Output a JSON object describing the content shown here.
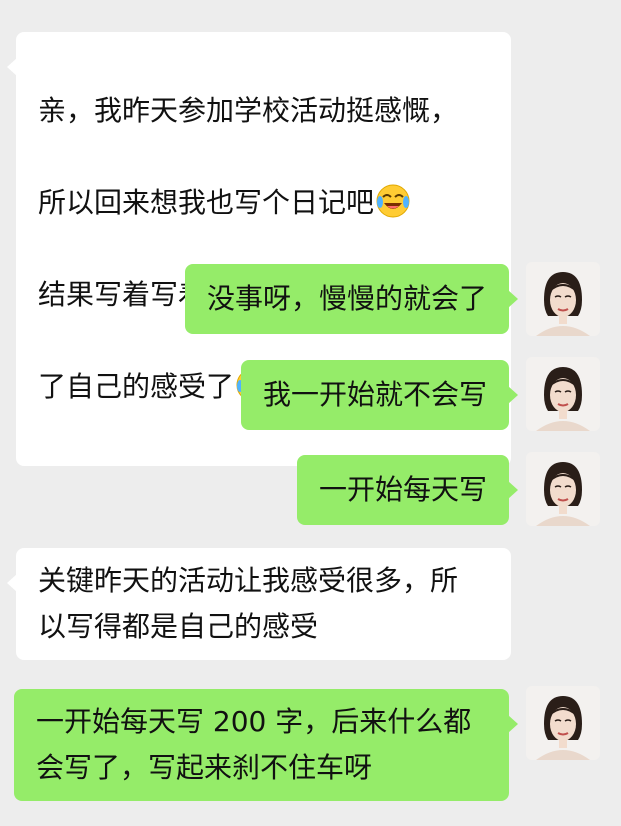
{
  "chat": {
    "messages": [
      {
        "side": "received",
        "lines": [
          "亲，我昨天参加学校活动挺感慨，",
          "所以回来想我也写个日记吧"
        ],
        "emoji_after_line_2": "face-with-tears-of-joy-icon",
        "lines_b": [
          "结果写着写着好像不是日记了，成",
          "了自己的感受了"
        ],
        "emoji_after_line_4": "face-with-tears-of-joy-icon"
      },
      {
        "side": "sent",
        "text": "没事呀，慢慢的就会了"
      },
      {
        "side": "sent",
        "text": "我一开始就不会写"
      },
      {
        "side": "sent",
        "text": "一开始每天写"
      },
      {
        "side": "received",
        "text": "关键昨天的活动让我感受很多，所\n以写得都是自己的感受"
      },
      {
        "side": "sent",
        "text": "一开始每天写 200 字，后来什么都\n会写了，写起来刹不住车呀"
      }
    ],
    "m1": {
      "l1": "亲，我昨天参加学校活动挺感慨，",
      "l2": "所以回来想我也写个日记吧",
      "l3": "结果写着写着好像不是日记了，成",
      "l4": "了自己的感受了"
    }
  },
  "colors": {
    "background": "#ededed",
    "received_bubble": "#ffffff",
    "sent_bubble": "#95ec69",
    "text": "#111111"
  },
  "icons": {
    "emoji": "face-with-tears-of-joy-icon",
    "avatar": "user-avatar-portrait"
  }
}
